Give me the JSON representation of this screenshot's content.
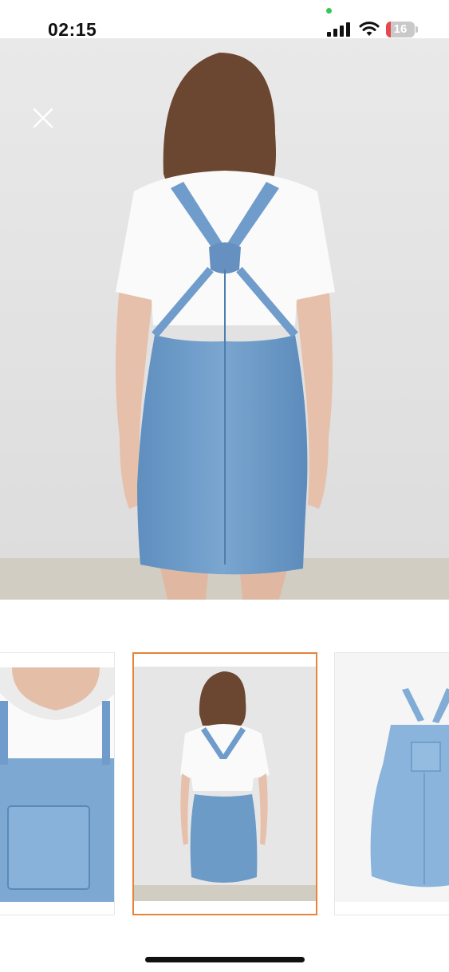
{
  "status_bar": {
    "time": "02:15",
    "battery_level": "16",
    "battery_fraction": 0.16,
    "icons": [
      "signal-icon",
      "wifi-icon",
      "battery-icon"
    ]
  },
  "viewer": {
    "close_icon": "close-icon",
    "main_image": "product-photo-back-view",
    "thumbnails": [
      {
        "name": "thumbnail-front-detail",
        "selected": false
      },
      {
        "name": "thumbnail-back-view",
        "selected": true
      },
      {
        "name": "thumbnail-flat-lay",
        "selected": false
      }
    ]
  },
  "colors": {
    "accent": "#e8833a",
    "denim": "#6d9bc8",
    "battery_low": "#e5484d"
  }
}
